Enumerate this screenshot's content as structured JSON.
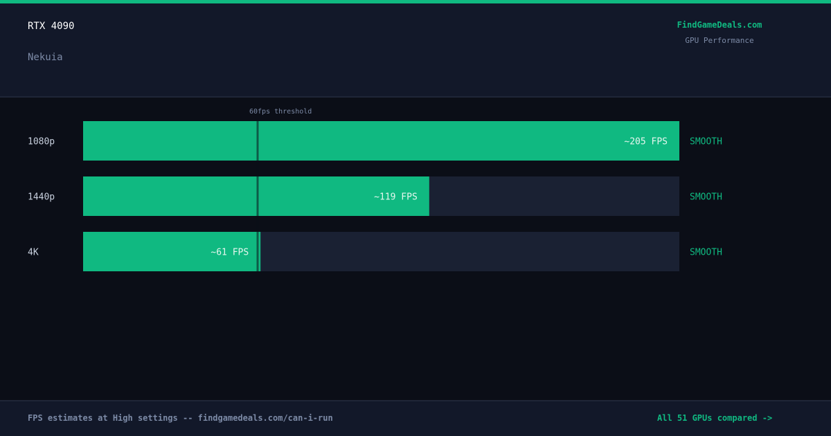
{
  "header": {
    "gpu": "RTX 4090",
    "game": "Nekuia",
    "brand": "FindGameDeals.com",
    "brand_subtitle": "GPU Performance"
  },
  "footer": {
    "note": "FPS estimates at High settings -- findgamedeals.com/can-i-run",
    "link": "All 51 GPUs compared ->"
  },
  "colors": {
    "accent": "#10b981",
    "track": "#1a2133",
    "background": "#0b0e17",
    "panel": "#121829",
    "muted": "#7c8aa6"
  },
  "chart_data": {
    "type": "bar",
    "orientation": "horizontal",
    "categories": [
      "1080p",
      "1440p",
      "4K"
    ],
    "values": [
      205,
      119,
      61
    ],
    "value_labels": [
      "~205 FPS",
      "~119 FPS",
      "~61 FPS"
    ],
    "status": [
      "SMOOTH",
      "SMOOTH",
      "SMOOTH"
    ],
    "xlim": [
      0,
      205
    ],
    "threshold": {
      "value": 60,
      "label": "60fps threshold"
    },
    "grid": false
  }
}
